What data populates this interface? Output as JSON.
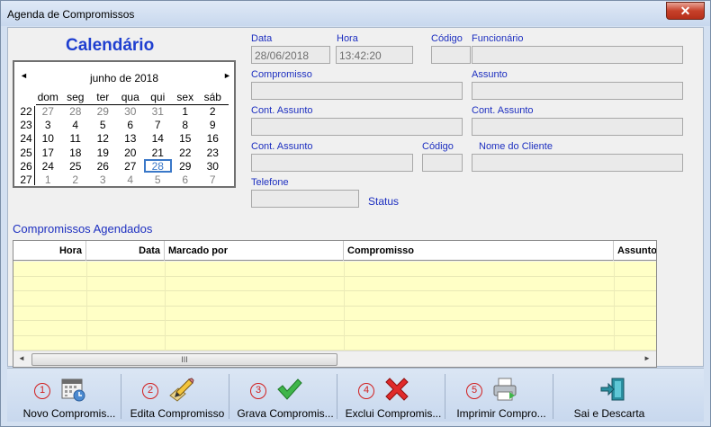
{
  "window": {
    "title": "Agenda de Compromissos",
    "close_label": "✕"
  },
  "calendar": {
    "title": "Calendário",
    "month_label": "junho de 2018",
    "prev_arrow": "◄",
    "next_arrow": "►",
    "weekdays": [
      "dom",
      "seg",
      "ter",
      "qua",
      "qui",
      "sex",
      "sáb"
    ],
    "weeks": [
      {
        "wk": "22",
        "days": [
          "27",
          "28",
          "29",
          "30",
          "31",
          "1",
          "2"
        ],
        "gray": [
          0,
          1,
          2,
          3,
          4
        ]
      },
      {
        "wk": "23",
        "days": [
          "3",
          "4",
          "5",
          "6",
          "7",
          "8",
          "9"
        ],
        "gray": []
      },
      {
        "wk": "24",
        "days": [
          "10",
          "11",
          "12",
          "13",
          "14",
          "15",
          "16"
        ],
        "gray": []
      },
      {
        "wk": "25",
        "days": [
          "17",
          "18",
          "19",
          "20",
          "21",
          "22",
          "23"
        ],
        "gray": []
      },
      {
        "wk": "26",
        "days": [
          "24",
          "25",
          "26",
          "27",
          "28",
          "29",
          "30"
        ],
        "gray": [],
        "today": 4
      },
      {
        "wk": "27",
        "days": [
          "1",
          "2",
          "3",
          "4",
          "5",
          "6",
          "7"
        ],
        "gray": [
          0,
          1,
          2,
          3,
          4,
          5,
          6
        ]
      }
    ]
  },
  "form": {
    "data_label": "Data",
    "data_value": "28/06/2018",
    "hora_label": "Hora",
    "hora_value": "13:42:20",
    "codigo_label": "Código",
    "funcionario_label": "Funcionário",
    "compromisso_label": "Compromisso",
    "assunto_label": "Assunto",
    "cont_assunto_label_1": "Cont. Assunto",
    "cont_assunto_label_2": "Cont. Assunto",
    "cont_assunto_label_3": "Cont. Assunto",
    "codigo2_label": "Código",
    "nome_cliente_label": "Nome do Cliente",
    "telefone_label": "Telefone",
    "status_label": "Status"
  },
  "grid": {
    "title": "Compromissos Agendados",
    "columns": [
      "Hora",
      "Data",
      "Marcado por",
      "Compromisso",
      "Assunto"
    ],
    "scroll_thumb": "III",
    "left_arrow": "◄",
    "right_arrow": "►"
  },
  "toolbar": {
    "buttons": [
      {
        "num": "1",
        "label": "Novo Compromis...",
        "icon": "calendar-icon"
      },
      {
        "num": "2",
        "label": "Edita Compromisso",
        "icon": "pencil-icon"
      },
      {
        "num": "3",
        "label": "Grava Compromis...",
        "icon": "checkmark-icon"
      },
      {
        "num": "4",
        "label": "Exclui Compromis...",
        "icon": "delete-x-icon"
      },
      {
        "num": "5",
        "label": "Imprimir Compro...",
        "icon": "printer-icon"
      },
      {
        "num": "",
        "label": "Sai e Descarta",
        "icon": "exit-door-icon"
      }
    ]
  },
  "colors": {
    "label_blue": "#1d2fc0",
    "grid_yellow": "#ffffc6",
    "badge_red": "#d11d1d"
  }
}
